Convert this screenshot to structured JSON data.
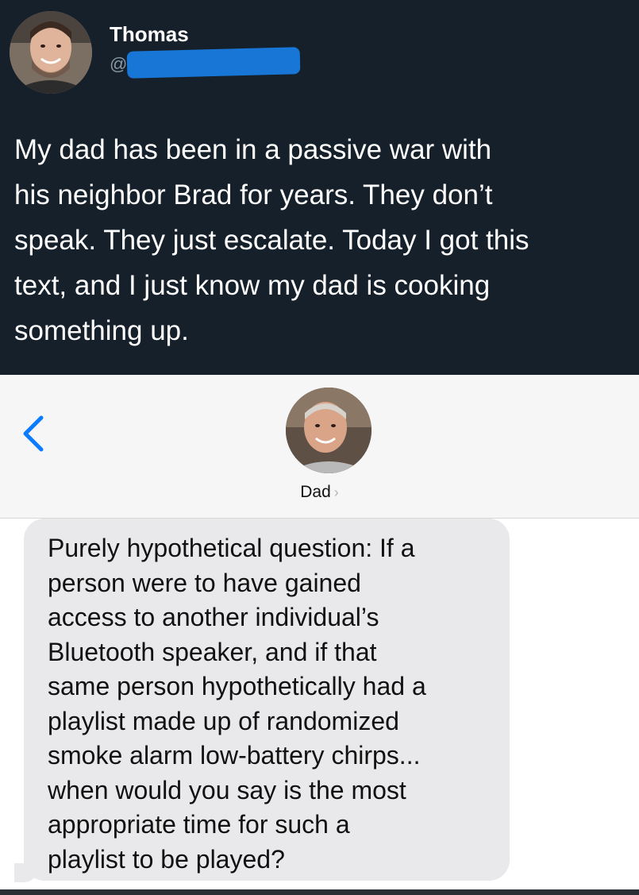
{
  "tweet": {
    "author_name": "Thomas",
    "handle_prefix": "@",
    "text": "My dad has been in a passive war with\nhis neighbor Brad for years. They don’t\nspeak. They just escalate. Today I got this\ntext, and I just know my dad is cooking\nsomething up."
  },
  "messages_header": {
    "contact_name": "Dad",
    "back_icon": "chevron-left-icon",
    "name_chevron": "›"
  },
  "conversation": {
    "messages": [
      {
        "direction": "incoming",
        "text": "Purely hypothetical question: If a\nperson were to have gained\naccess to another individual’s\nBluetooth speaker, and if that\nsame person hypothetically had a\nplaylist made up of randomized\nsmoke alarm low-battery chirps...\nwhen would you say is the most\nappropriate time for such a\nplaylist to be played?"
      }
    ]
  },
  "colors": {
    "tweet_background": "#15202b",
    "tweet_text": "#ffffff",
    "handle_text": "#8899a6",
    "redaction": "#1877d6",
    "ios_accent": "#0a7cff",
    "bubble_incoming": "#e9e9eb"
  }
}
